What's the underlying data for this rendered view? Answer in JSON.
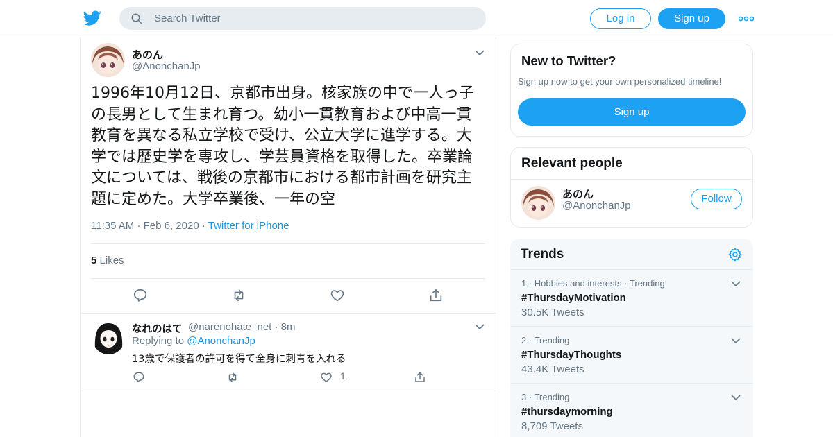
{
  "header": {
    "search_placeholder": "Search Twitter",
    "login_label": "Log in",
    "signup_label": "Sign up"
  },
  "tweet": {
    "name": "あのん",
    "handle": "@AnonchanJp",
    "text": "1996年10月12日、京都市出身。核家族の中で一人っ子の長男として生まれ育つ。幼小一貫教育および中高一貫教育を異なる私立学校で受け、公立大学に進学する。大学では歴史学を専攻し、学芸員資格を取得した。卒業論文については、戦後の京都市における都市計画を研究主題に定めた。大学卒業後、一年の空",
    "time": "11:35 AM",
    "date": "Feb 6, 2020",
    "source": "Twitter for iPhone",
    "likes_count": "5",
    "likes_label": "Likes"
  },
  "reply": {
    "name": "なれのはて",
    "handle": "@narenohate_net",
    "time": "8m",
    "replying_to_label": "Replying to",
    "replying_to_handle": "@AnonchanJp",
    "text": "13歳で保護者の許可を得て全身に刺青を入れる",
    "like_count": "1"
  },
  "sidebar": {
    "new_title": "New to Twitter?",
    "new_sub": "Sign up now to get your own personalized timeline!",
    "signup_label": "Sign up",
    "relevant_title": "Relevant people",
    "person": {
      "name": "あのん",
      "handle": "@AnonchanJp",
      "follow_label": "Follow"
    },
    "trends_title": "Trends",
    "trends": [
      {
        "rank": "1",
        "context": "Hobbies and interests · Trending",
        "tag": "#ThursdayMotivation",
        "count": "30.5K Tweets"
      },
      {
        "rank": "2",
        "context": "Trending",
        "tag": "#ThursdayThoughts",
        "count": "43.4K Tweets"
      },
      {
        "rank": "3",
        "context": "Trending",
        "tag": "#thursdaymorning",
        "count": "8,709 Tweets"
      }
    ]
  },
  "colors": {
    "accent": "#1da1f2",
    "link": "#1b95e0",
    "muted": "#657786",
    "border": "#e6ecf0"
  }
}
